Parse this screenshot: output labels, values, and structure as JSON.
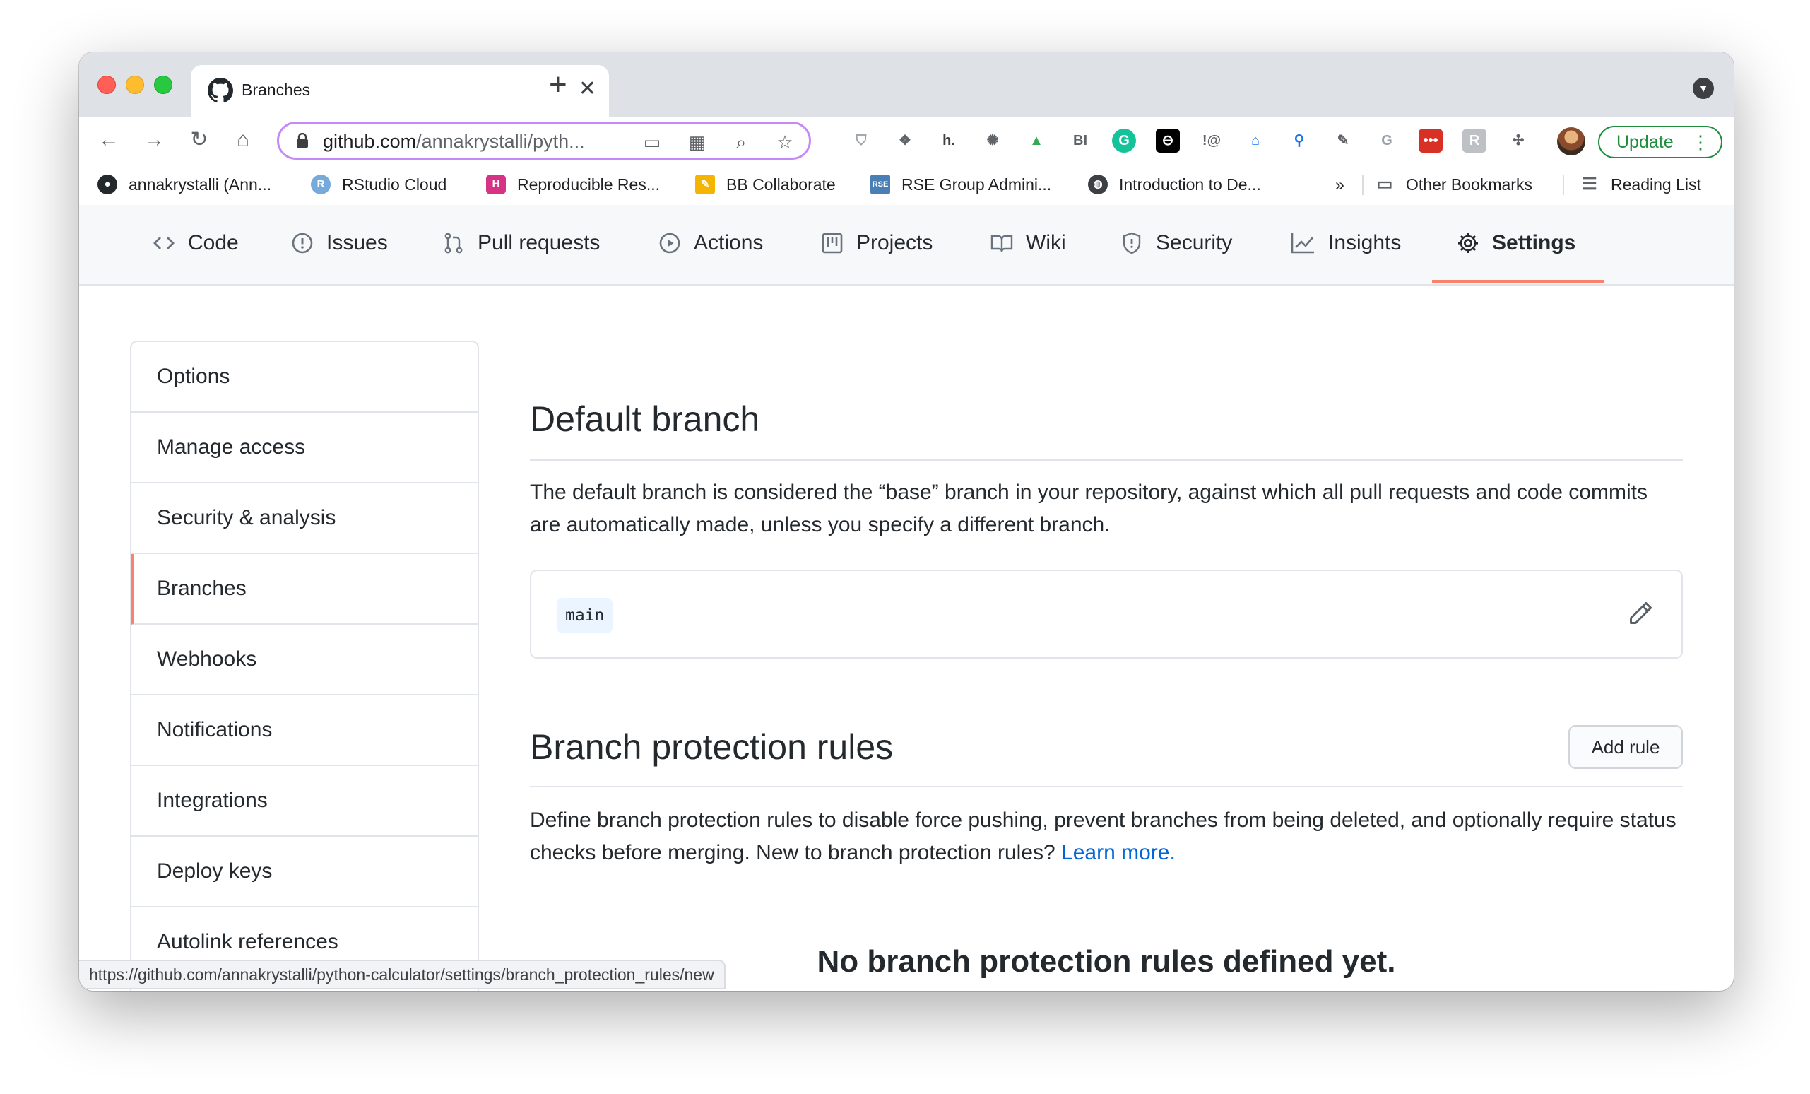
{
  "browser": {
    "tab_title": "Branches",
    "url_host": "github.com",
    "url_path": "/annakrystalli/pyth...",
    "update_label": "Update",
    "status_url": "https://github.com/annakrystalli/python-calculator/settings/branch_protection_rules/new"
  },
  "bookmarks": [
    {
      "label": "annakrystalli (Ann...",
      "icon": "github-icon"
    },
    {
      "label": "RStudio Cloud",
      "icon": "rstudio-icon"
    },
    {
      "label": "Reproducible Res...",
      "icon": "hexagon-icon"
    },
    {
      "label": "BB Collaborate",
      "icon": "pencil-icon"
    },
    {
      "label": "RSE Group Admini...",
      "icon": "rse-icon"
    },
    {
      "label": "Introduction to De...",
      "icon": "globe-icon"
    },
    {
      "label": "»",
      "icon": "overflow"
    },
    {
      "label": "Other Bookmarks",
      "icon": "folder-icon"
    },
    {
      "label": "Reading List",
      "icon": "reading-list-icon"
    }
  ],
  "repo_nav": [
    {
      "label": "Code",
      "icon": "code-icon"
    },
    {
      "label": "Issues",
      "icon": "issue-icon"
    },
    {
      "label": "Pull requests",
      "icon": "pull-request-icon"
    },
    {
      "label": "Actions",
      "icon": "play-icon"
    },
    {
      "label": "Projects",
      "icon": "project-icon"
    },
    {
      "label": "Wiki",
      "icon": "book-icon"
    },
    {
      "label": "Security",
      "icon": "shield-icon"
    },
    {
      "label": "Insights",
      "icon": "graph-icon"
    },
    {
      "label": "Settings",
      "icon": "gear-icon",
      "active": true
    }
  ],
  "sidebar": [
    {
      "label": "Options"
    },
    {
      "label": "Manage access"
    },
    {
      "label": "Security & analysis"
    },
    {
      "label": "Branches",
      "active": true
    },
    {
      "label": "Webhooks"
    },
    {
      "label": "Notifications"
    },
    {
      "label": "Integrations"
    },
    {
      "label": "Deploy keys"
    },
    {
      "label": "Autolink references"
    }
  ],
  "main": {
    "default_branch": {
      "title": "Default branch",
      "description": "The default branch is considered the “base” branch in your repository, against which all pull requests and code commits are automatically made, unless you specify a different branch.",
      "branch_name": "main"
    },
    "protection": {
      "title": "Branch protection rules",
      "add_rule_label": "Add rule",
      "description": "Define branch protection rules to disable force pushing, prevent branches from being deleted, and optionally require status checks before merging. New to branch protection rules?",
      "learn_more": "Learn more.",
      "empty_title": "No branch protection rules defined yet."
    }
  },
  "colors": {
    "accent_underline": "#f9826c",
    "link": "#0366d6",
    "update_green": "#1e8e3e",
    "omnibox_focus": "#c58af9"
  }
}
